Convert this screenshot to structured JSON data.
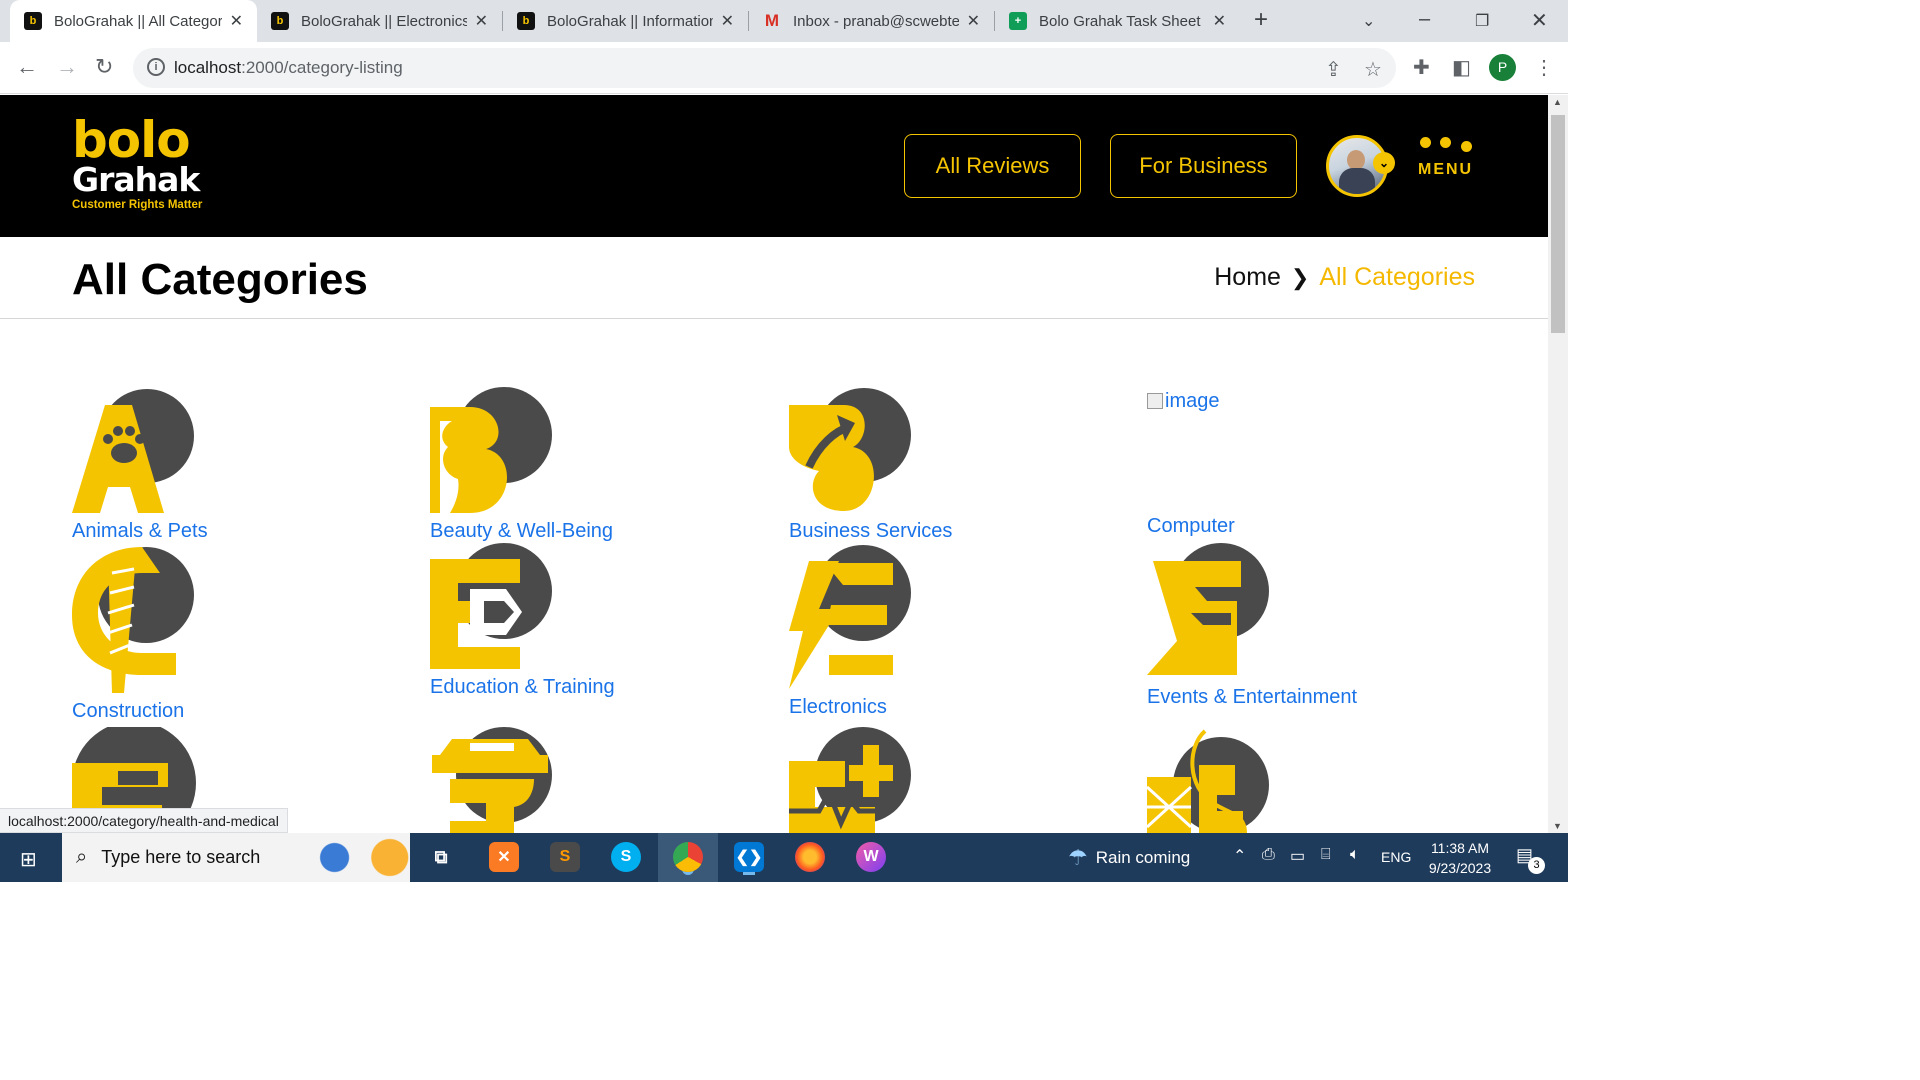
{
  "browser": {
    "tabs": [
      {
        "title": "BoloGrahak || All Categories",
        "active": true
      },
      {
        "title": "BoloGrahak || Electronics",
        "active": false
      },
      {
        "title": "BoloGrahak || Information",
        "active": false
      },
      {
        "title": "Inbox - pranab@scwebtech",
        "active": false
      },
      {
        "title": "Bolo Grahak Task Sheet - Google Sheets",
        "active": false
      }
    ],
    "url_host": "localhost",
    "url_rest": ":2000/category-listing",
    "profile_initial": "P"
  },
  "header": {
    "logo_line1": "bolo",
    "logo_line2": "Grahak",
    "logo_tagline": "Customer Rights Matter",
    "all_reviews": "All Reviews",
    "for_business": "For Business",
    "menu_label": "MENU"
  },
  "page": {
    "title": "All Categories",
    "breadcrumb_home": "Home",
    "breadcrumb_current": "All Categories"
  },
  "categories": [
    {
      "label": "Animals & Pets",
      "icon": "paw-letter-a-icon"
    },
    {
      "label": "Beauty & Well-Being",
      "icon": "face-letter-b-icon"
    },
    {
      "label": "Business Services",
      "icon": "arrow-letter-b-icon"
    },
    {
      "label": "Computer",
      "icon": "broken-image-icon",
      "alt": "image"
    },
    {
      "label": "Construction",
      "icon": "drill-letter-c-icon"
    },
    {
      "label": "Education & Training",
      "icon": "pen-letter-e-icon"
    },
    {
      "label": "Electronics",
      "icon": "bolt-letter-e-icon"
    },
    {
      "label": "Events & Entertainment",
      "icon": "chat-letter-e-icon"
    },
    {
      "label": "",
      "icon": "food-icon"
    },
    {
      "label": "",
      "icon": "government-icon"
    },
    {
      "label": "",
      "icon": "health-and-medical-icon"
    },
    {
      "label": "",
      "icon": "home-services-icon"
    }
  ],
  "status_bar": "localhost:2000/category/health-and-medical",
  "taskbar": {
    "search_placeholder": "Type here to search",
    "weather": "Rain coming",
    "lang": "ENG",
    "time": "11:38 AM",
    "date": "9/23/2023",
    "notifications": "3"
  },
  "colors": {
    "brand_yellow": "#f5c400",
    "icon_gray": "#4a4a4a",
    "link_blue": "#1a73e8"
  }
}
